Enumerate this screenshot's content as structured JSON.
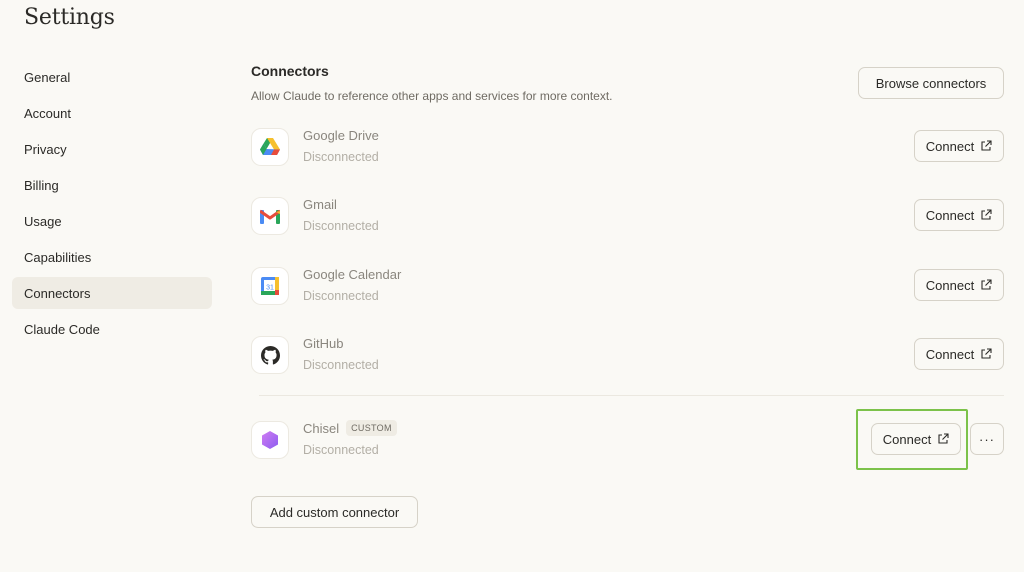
{
  "page_title": "Settings",
  "sidebar": {
    "items": [
      {
        "label": "General"
      },
      {
        "label": "Account"
      },
      {
        "label": "Privacy"
      },
      {
        "label": "Billing"
      },
      {
        "label": "Usage"
      },
      {
        "label": "Capabilities"
      },
      {
        "label": "Connectors",
        "active": true
      },
      {
        "label": "Claude Code"
      }
    ]
  },
  "connectors": {
    "title": "Connectors",
    "description": "Allow Claude to reference other apps and services for more context.",
    "browse_label": "Browse connectors",
    "items": [
      {
        "name": "Google Drive",
        "status": "Disconnected",
        "action": "Connect",
        "icon": "google-drive-icon"
      },
      {
        "name": "Gmail",
        "status": "Disconnected",
        "action": "Connect",
        "icon": "gmail-icon"
      },
      {
        "name": "Google Calendar",
        "status": "Disconnected",
        "action": "Connect",
        "icon": "google-calendar-icon",
        "icon_text": "31"
      },
      {
        "name": "GitHub",
        "status": "Disconnected",
        "action": "Connect",
        "icon": "github-icon"
      },
      {
        "name": "Chisel",
        "badge": "CUSTOM",
        "status": "Disconnected",
        "action": "Connect",
        "icon": "chisel-icon",
        "more": "···"
      }
    ],
    "add_custom_label": "Add custom connector"
  },
  "colors": {
    "background": "#faf9f5",
    "active_nav": "#efece4",
    "highlight": "#7cc24a",
    "chisel": "#b86bf0"
  }
}
